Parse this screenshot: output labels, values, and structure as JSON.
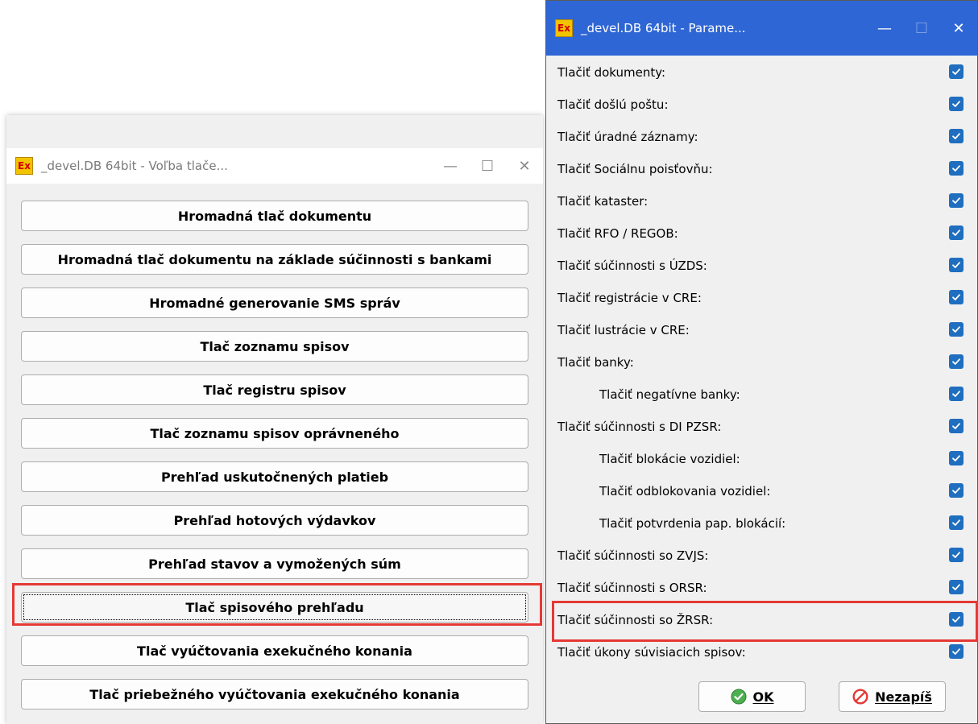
{
  "left_window": {
    "title": "_devel.DB 64bit - Voľba tlače...",
    "app_icon_text": "Ex",
    "controls": {
      "minimize": "—",
      "maximize": "☐",
      "close": "✕"
    },
    "buttons": [
      {
        "label": "Hromadná tlač dokumentu"
      },
      {
        "label": "Hromadná tlač dokumentu na základe súčinnosti s bankami"
      },
      {
        "label": "Hromadné generovanie SMS správ"
      },
      {
        "label": "Tlač zoznamu spisov"
      },
      {
        "label": "Tlač registru spisov"
      },
      {
        "label": "Tlač zoznamu spisov oprávneného"
      },
      {
        "label": "Prehľad uskutočnených platieb"
      },
      {
        "label": "Prehľad hotových výdavkov"
      },
      {
        "label": "Prehľad stavov a vymožených súm"
      },
      {
        "label": "Tlač spisového prehľadu"
      },
      {
        "label": "Tlač vyúčtovania exekučného konania"
      },
      {
        "label": "Tlač priebežného vyúčtovania exekučného konania"
      }
    ]
  },
  "right_window": {
    "title": "_devel.DB 64bit - Parame...",
    "app_icon_text": "Ex",
    "controls": {
      "minimize": "—",
      "maximize": "☐",
      "close": "✕"
    },
    "options": [
      {
        "label": "Tlačiť dokumenty:",
        "checked": true
      },
      {
        "label": "Tlačiť došlú poštu:",
        "checked": true
      },
      {
        "label": "Tlačiť úradné záznamy:",
        "checked": true
      },
      {
        "label": "Tlačiť Sociálnu poisťovňu:",
        "checked": true
      },
      {
        "label": "Tlačiť kataster:",
        "checked": true
      },
      {
        "label": "Tlačiť RFO / REGOB:",
        "checked": true
      },
      {
        "label": "Tlačiť súčinnosti s ÚZDS:",
        "checked": true
      },
      {
        "label": "Tlačiť registrácie v CRE:",
        "checked": true
      },
      {
        "label": "Tlačiť lustrácie v CRE:",
        "checked": true
      },
      {
        "label": "Tlačiť banky:",
        "checked": true
      },
      {
        "label": "Tlačiť negatívne banky:",
        "checked": true
      },
      {
        "label": "Tlačiť súčinnosti s DI PZSR:",
        "checked": true
      },
      {
        "label": "Tlačiť blokácie vozidiel:",
        "checked": true
      },
      {
        "label": "Tlačiť odblokovania vozidiel:",
        "checked": true
      },
      {
        "label": "Tlačiť potvrdenia pap. blokácií:",
        "checked": true
      },
      {
        "label": "Tlačiť súčinnosti so ZVJS:",
        "checked": true
      },
      {
        "label": "Tlačiť súčinnosti s ORSR:",
        "checked": true
      },
      {
        "label": "Tlačiť súčinnosti so ŽRSR:",
        "checked": true
      },
      {
        "label": "Tlačiť úkony súvisiacich spisov:",
        "checked": true
      }
    ],
    "ok_label": "OK",
    "cancel_label": "Nezapíš"
  },
  "colors": {
    "accent_titlebar": "#2f66d5",
    "checkbox": "#1f6ebf",
    "highlight": "#e53935",
    "ok_icon": "#4caf50",
    "cancel_icon": "#e53935"
  }
}
